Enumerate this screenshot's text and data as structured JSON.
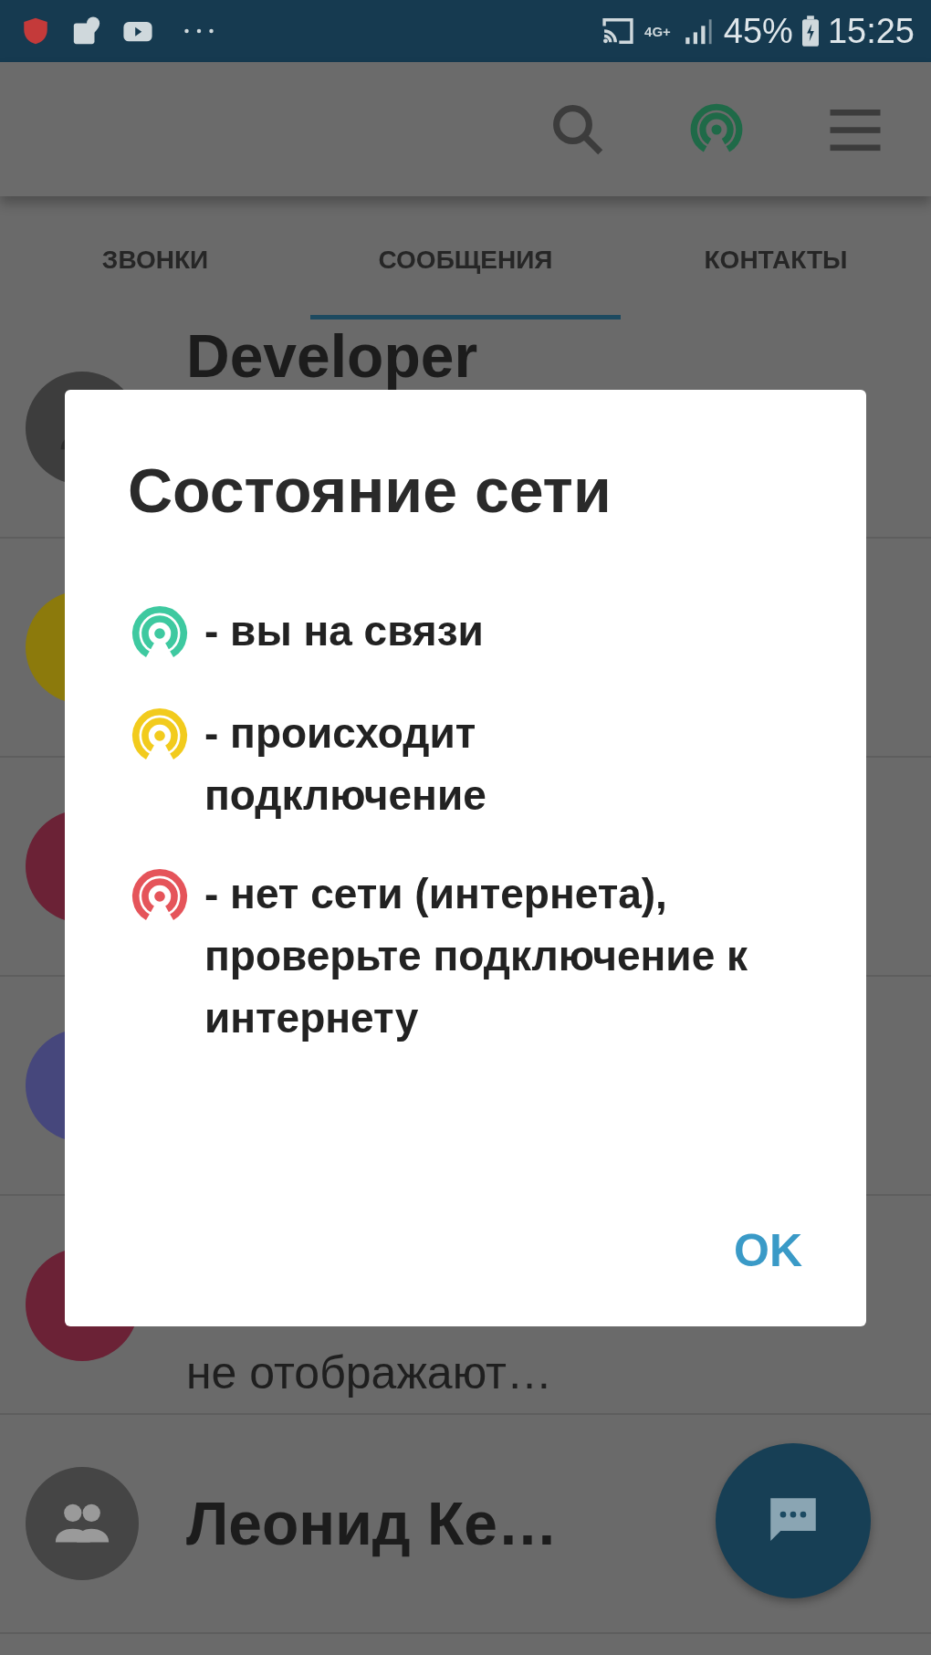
{
  "status_bar": {
    "network": "4G+",
    "battery": "45%",
    "time": "15:25"
  },
  "tabs": [
    {
      "label": "ЗВОНКИ",
      "selected": false
    },
    {
      "label": "СООБЩЕНИЯ",
      "selected": true
    },
    {
      "label": "КОНТАКТЫ",
      "selected": false
    }
  ],
  "conversations": [
    {
      "kind": "person",
      "color": "#3d3d3d",
      "title": "Developer"
    },
    {
      "kind": "letter",
      "color": "#8c7a0c"
    },
    {
      "kind": "letter",
      "color": "#6b2236"
    },
    {
      "kind": "letter",
      "color": "#46477c"
    },
    {
      "kind": "letter",
      "color": "#6b2236",
      "preview": "не отображают…"
    },
    {
      "kind": "group",
      "color": "#454545",
      "title": "Леонид Ке…"
    }
  ],
  "dialog": {
    "title": "Состояние сети",
    "items": [
      {
        "color": "#3ec9a0",
        "text": "- вы на связи"
      },
      {
        "color": "#f2cb1d",
        "text": "- происходит подключение"
      },
      {
        "color": "#e5545a",
        "text": "- нет сети (интернета), проверьте подключение к интернету"
      }
    ],
    "button": "OK"
  }
}
